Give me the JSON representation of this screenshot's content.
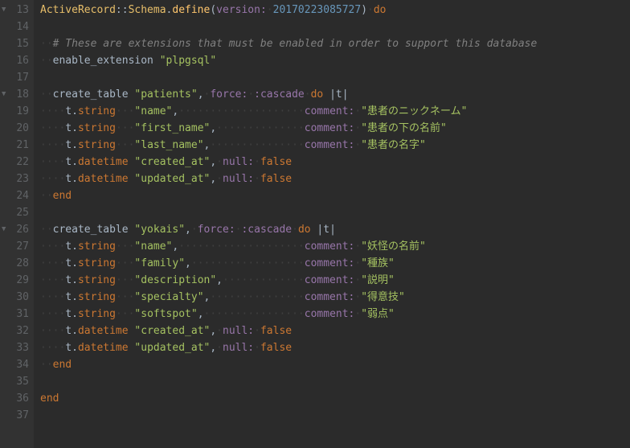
{
  "gutter": {
    "start": 13,
    "end": 37,
    "fold_lines": [
      13,
      18,
      26
    ]
  },
  "l13": {
    "const": "ActiveRecord",
    "sep": "::",
    "schema": "Schema",
    "define": "define",
    "version_key": "version:",
    "version_val": "20170223085727",
    "do": "do"
  },
  "l15": {
    "comment": "# These are extensions that must be enabled in order to support this database"
  },
  "l16": {
    "method": "enable_extension",
    "arg": "\"plpgsql\""
  },
  "l18": {
    "method": "create_table",
    "name": "\"patients\"",
    "force_key": "force:",
    "force_val": ":cascade",
    "do": "do",
    "param": "t"
  },
  "l19": {
    "t": "t",
    "type": "string",
    "col": "\"name\"",
    "comment_key": "comment:",
    "comment_val": "\"患者のニックネーム\""
  },
  "l20": {
    "t": "t",
    "type": "string",
    "col": "\"first_name\"",
    "comment_key": "comment:",
    "comment_val": "\"患者の下の名前\""
  },
  "l21": {
    "t": "t",
    "type": "string",
    "col": "\"last_name\"",
    "comment_key": "comment:",
    "comment_val": "\"患者の名字\""
  },
  "l22": {
    "t": "t",
    "type": "datetime",
    "col": "\"created_at\"",
    "null_key": "null:",
    "null_val": "false"
  },
  "l23": {
    "t": "t",
    "type": "datetime",
    "col": "\"updated_at\"",
    "null_key": "null:",
    "null_val": "false"
  },
  "l24": {
    "end": "end"
  },
  "l26": {
    "method": "create_table",
    "name": "\"yokais\"",
    "force_key": "force:",
    "force_val": ":cascade",
    "do": "do",
    "param": "t"
  },
  "l27": {
    "t": "t",
    "type": "string",
    "col": "\"name\"",
    "comment_key": "comment:",
    "comment_val": "\"妖怪の名前\""
  },
  "l28": {
    "t": "t",
    "type": "string",
    "col": "\"family\"",
    "comment_key": "comment:",
    "comment_val": "\"種族\""
  },
  "l29": {
    "t": "t",
    "type": "string",
    "col": "\"description\"",
    "comment_key": "comment:",
    "comment_val": "\"説明\""
  },
  "l30": {
    "t": "t",
    "type": "string",
    "col": "\"specialty\"",
    "comment_key": "comment:",
    "comment_val": "\"得意技\""
  },
  "l31": {
    "t": "t",
    "type": "string",
    "col": "\"softspot\"",
    "comment_key": "comment:",
    "comment_val": "\"弱点\""
  },
  "l32": {
    "t": "t",
    "type": "datetime",
    "col": "\"created_at\"",
    "null_key": "null:",
    "null_val": "false"
  },
  "l33": {
    "t": "t",
    "type": "datetime",
    "col": "\"updated_at\"",
    "null_key": "null:",
    "null_val": "false"
  },
  "l34": {
    "end": "end"
  },
  "l36": {
    "end": "end"
  },
  "dots": {
    "d1": "·",
    "d2": "··",
    "d4": "····",
    "d6": "······",
    "d7": "·······",
    "d8": "········",
    "d12": "············",
    "d13": "·············",
    "d14": "··············",
    "d15": "···············",
    "d19": "···················",
    "d20": "····················"
  }
}
